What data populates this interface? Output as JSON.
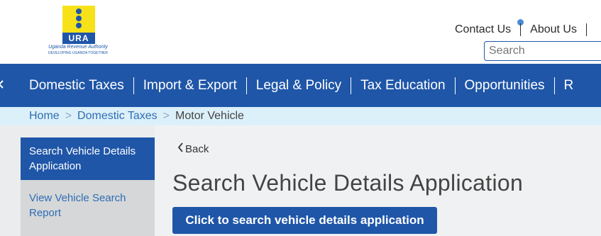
{
  "logo": {
    "initials": "URA",
    "name": "Uganda Revenue Authority",
    "tagline": "DEVELOPING UGANDA TOGETHER",
    "colors": {
      "yellow": "#f7e21a",
      "blue": "#1f56a8"
    }
  },
  "top_links": [
    {
      "label": "Contact Us"
    },
    {
      "label": "About Us"
    }
  ],
  "search": {
    "placeholder": "Search",
    "value": ""
  },
  "nav": {
    "home_icon": "home-icon",
    "items": [
      {
        "label": "Domestic Taxes"
      },
      {
        "label": "Import & Export"
      },
      {
        "label": "Legal & Policy"
      },
      {
        "label": "Tax Education"
      },
      {
        "label": "Opportunities"
      },
      {
        "label": "R"
      }
    ]
  },
  "breadcrumb": {
    "items": [
      {
        "label": "Home"
      },
      {
        "label": "Domestic Taxes"
      }
    ],
    "separator": ">",
    "current": "Motor Vehicle"
  },
  "sidebar": {
    "active_item": "Search Vehicle Details Application",
    "items": [
      {
        "label": "View Vehicle Search Report"
      }
    ]
  },
  "main": {
    "back_label": "Back",
    "title": "Search Vehicle Details Application",
    "cta_label": "Click to search vehicle details application"
  },
  "theme": {
    "primary": "#1f56a8",
    "breadcrumb_bg": "#dcf0fa",
    "link": "#2f6db5",
    "content_bg": "#eaeced"
  }
}
